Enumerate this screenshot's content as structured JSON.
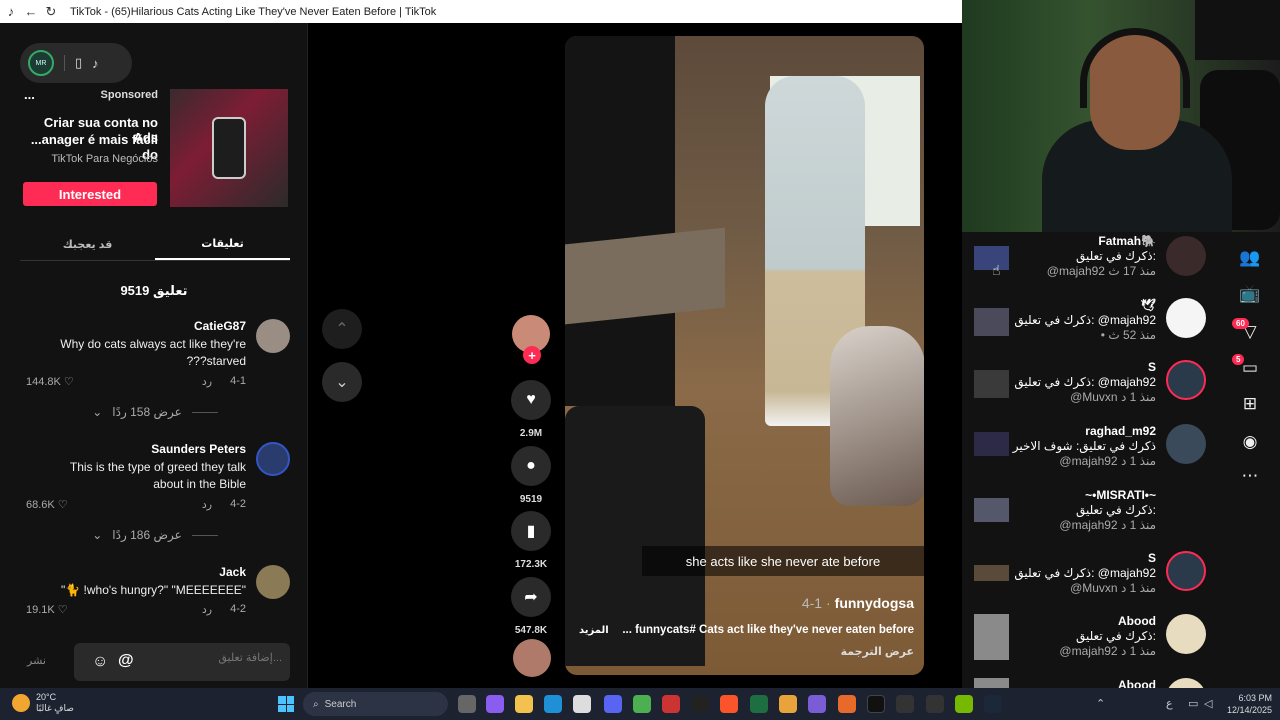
{
  "window": {
    "title": "TikTok - (65)Hilarious Cats Acting Like They've Never Eaten Before | TikTok"
  },
  "ad": {
    "sponsored": "Sponsored",
    "line1": "Criar sua conta no Ads",
    "line2": "...anager é mais fácil do",
    "advertiser": "TikTok Para Negócios",
    "button": "Interested",
    "more": "..."
  },
  "tabs": {
    "comments": "تعليقات",
    "you_may_like": "قد يعجبك"
  },
  "comments_count": "9519 تعليق",
  "comments": [
    {
      "name": "CatieG87",
      "text": "Why do cats always act like they're ???starved",
      "date": "4-1",
      "reply": "رد",
      "likes": "144.8K",
      "view_replies": "عرض 158 ردًا"
    },
    {
      "name": "Saunders Peters",
      "text": "This is the type of greed they talk about in the Bible",
      "date": "4-2",
      "reply": "رد",
      "likes": "68.6K",
      "view_replies": "عرض 186 ردًا"
    },
    {
      "name": "Jack",
      "text": "\"🐈 !who's hungry?\" \"MEEEEEEE\"",
      "date": "4-2",
      "reply": "رد",
      "likes": "19.1K"
    }
  ],
  "comment_input": {
    "placeholder": "إضافة تعليق...",
    "post": "نشر"
  },
  "actions": {
    "likes": "2.9M",
    "comments": "9519",
    "saves": "172.3K",
    "shares": "547.8K"
  },
  "video": {
    "subtitle": "she acts like she never ate before",
    "author": "funnydogsa",
    "date": "4-1 ·",
    "description": "... funnycats# Cats act like they've never eaten before",
    "more": "المزيد",
    "translate": "عرض الترجمة"
  },
  "notifications": [
    {
      "name": "Fatmah🐘",
      "line1": "ذكرك في تعليق:",
      "line2": "@majah92 منذ 17 ث",
      "avatar": "#3a2a2a"
    },
    {
      "name": "🕊",
      "line1": "ذكرك في تعليق: @majah92",
      "line2": "• منذ 52 ث",
      "avatar": "#f5f5f5"
    },
    {
      "name": "S",
      "line1": "ذكرك في تعليق: @majah92",
      "line2": "@Muvxn منذ 1 د",
      "avatar": "#2a3a4a"
    },
    {
      "name": "raghad_m92",
      "line1": "ذكرك في تعليق: شوف الاخير",
      "line2": "@majah92 منذ 1 د",
      "avatar": "#3a4a5a"
    },
    {
      "name": "~•MISRATI•~",
      "line1": "ذكرك في تعليق:",
      "line2": "@majah92 منذ 1 د",
      "avatar": "#121212"
    },
    {
      "name": "S",
      "line1": "ذكرك في تعليق: @majah92",
      "line2": "@Muvxn منذ 1 د",
      "avatar": "#2a3a4a"
    },
    {
      "name": "Abood",
      "line1": "ذكرك في تعليق:",
      "line2": "@majah92 منذ 1 د",
      "avatar": "#e8dcc0"
    },
    {
      "name": "Abood",
      "line1": "",
      "line2": "",
      "avatar": "#e8dcc0"
    }
  ],
  "rail": {
    "badge_activity": "60",
    "badge_messages": "5"
  },
  "taskbar": {
    "temp": "20°C",
    "weather": "صافٍ غالبًا",
    "search": "Search",
    "time": "6:03 PM",
    "date": "12/14/2025",
    "lang": "ع"
  }
}
